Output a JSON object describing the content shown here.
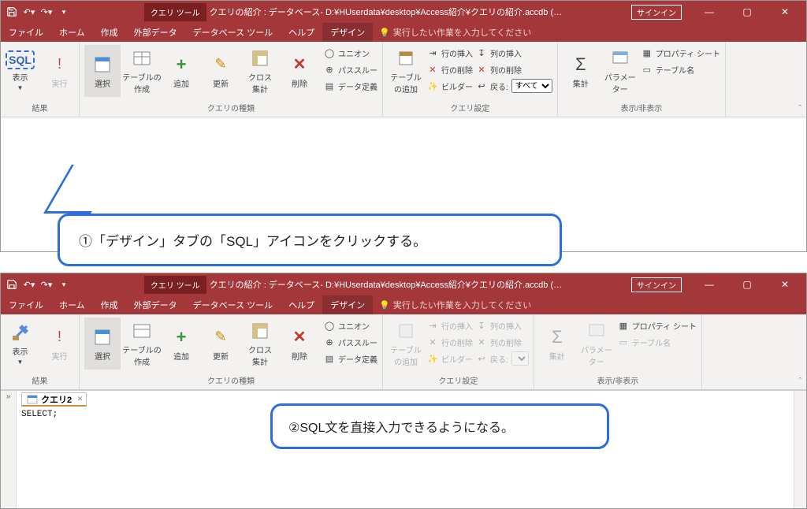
{
  "titlebar": {
    "context_tool": "クエリ ツール",
    "title": "クエリの紹介 : データベース- D:¥HUserdata¥desktop¥Access紹介¥クエリの紹介.accdb (…",
    "signin": "サインイン"
  },
  "menu": {
    "file": "ファイル",
    "home": "ホーム",
    "create": "作成",
    "external": "外部データ",
    "dbtools": "データベース ツール",
    "help": "ヘルプ",
    "design": "デザイン",
    "tell_me": "実行したい作業を入力してください"
  },
  "ribbon": {
    "results": {
      "group": "結果",
      "sql": "SQL",
      "view": "表示",
      "run": "実行"
    },
    "querytype": {
      "group": "クエリの種類",
      "select": "選択",
      "make_table": "テーブルの\n作成",
      "append": "追加",
      "update": "更新",
      "crosstab": "クロス\n集計",
      "delete": "削除",
      "union": "ユニオン",
      "passthrough": "パススルー",
      "datadef": "データ定義"
    },
    "querysetup": {
      "group": "クエリ設定",
      "show_table": "テーブル\nの追加",
      "insert_rows": "行の挿入",
      "delete_rows": "行の削除",
      "builder": "ビルダー",
      "insert_cols": "列の挿入",
      "delete_cols": "列の削除",
      "return_label": "戻る:",
      "return_value": "すべて"
    },
    "showhide": {
      "group": "表示/非表示",
      "totals": "集計",
      "parameters": "パラメーター",
      "property_sheet": "プロパティ シート",
      "table_names": "テーブル名"
    }
  },
  "callouts": {
    "step1": "①「デザイン」タブの「SQL」アイコンをクリックする。",
    "step2": "②SQL文を直接入力できるようになる。"
  },
  "doc": {
    "expand": "»",
    "query_tab": "クエリ2",
    "sql_text": "SELECT;"
  }
}
